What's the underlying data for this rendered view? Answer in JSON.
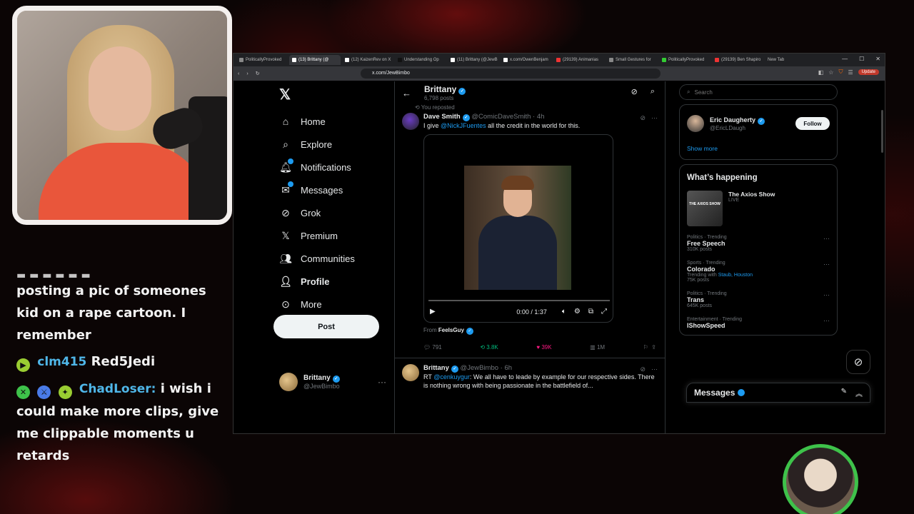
{
  "chat": {
    "cut_line": "▬ ▬ ▬ ▬ ▬ ▬",
    "messages": [
      {
        "user": "",
        "text": "posting a pic of someones kid on a rape cartoon. I remember"
      },
      {
        "user": "clm415",
        "text": "Red5Jedi"
      },
      {
        "user": "ChadLoser:",
        "text": "i wish i could make more clips, give me clippable moments u retards"
      }
    ]
  },
  "browser": {
    "tabs": [
      "PoliticallyProvoked",
      "(13) Brittany (@",
      "(12) KaizenRev on X",
      "Understanding Op",
      "(11) Brittany (@JewB",
      "x.com/OwenBenjam",
      "(29139) Animanias",
      "Small Gestures for",
      "PoliticallyProvoked",
      "(29139) Ben Shapiro",
      "New Tab"
    ],
    "url": "x.com/JewBimbo",
    "update_label": "Update"
  },
  "nav": {
    "items": [
      {
        "label": "Home"
      },
      {
        "label": "Explore"
      },
      {
        "label": "Notifications"
      },
      {
        "label": "Messages"
      },
      {
        "label": "Grok"
      },
      {
        "label": "Premium"
      },
      {
        "label": "Communities"
      },
      {
        "label": "Profile"
      },
      {
        "label": "More"
      }
    ],
    "post_label": "Post",
    "account": {
      "name": "Brittany",
      "handle": "@JewBimbo"
    }
  },
  "profile": {
    "name": "Brittany",
    "posts": "6,798 posts"
  },
  "tweet1": {
    "repost_label": "You reposted",
    "name": "Dave Smith",
    "handle": "@ComicDaveSmith · 4h",
    "text_pre": "I give ",
    "mention": "@NickJFuentes",
    "text_post": " all the credit in the world for this.",
    "video_time": "0:00 / 1:37",
    "from_label": "From ",
    "from_name": "FeelsGuy",
    "replies": "791",
    "reposts": "3.8K",
    "likes": "39K",
    "views": "1M"
  },
  "tweet2": {
    "name": "Brittany",
    "handle": "@JewBimbo · 6h",
    "text_pre": "RT ",
    "mention": "@cenkuygur",
    "text_post": ": We all have to leade by example for our respective sides. There is nothing wrong with being passionate in the battlefield of..."
  },
  "right": {
    "search_placeholder": "Search",
    "who": {
      "name": "Eric Daugherty",
      "handle": "@EricLDaugh",
      "follow_label": "Follow"
    },
    "show_more": "Show more",
    "whats_happening": "What’s happening",
    "axios": {
      "title": "The Axios Show",
      "status": "LIVE",
      "thumb": "THE AXIOS SHOW"
    },
    "trends": [
      {
        "category": "Politics · Trending",
        "name": "Free Speech",
        "count": "310K posts",
        "with": ""
      },
      {
        "category": "Sports · Trending",
        "name": "Colorado",
        "count": "75K posts",
        "with": "Trending with ",
        "with_links": "Staub, Houston"
      },
      {
        "category": "Politics · Trending",
        "name": "Trans",
        "count": "645K posts",
        "with": ""
      },
      {
        "category": "Entertainment · Trending",
        "name": "IShowSpeed",
        "count": "",
        "with": ""
      }
    ],
    "messages_label": "Messages"
  },
  "colors": {
    "accent": "#1d9bf0",
    "repost": "#00ba7c",
    "like": "#f91880",
    "background": "#000000"
  }
}
